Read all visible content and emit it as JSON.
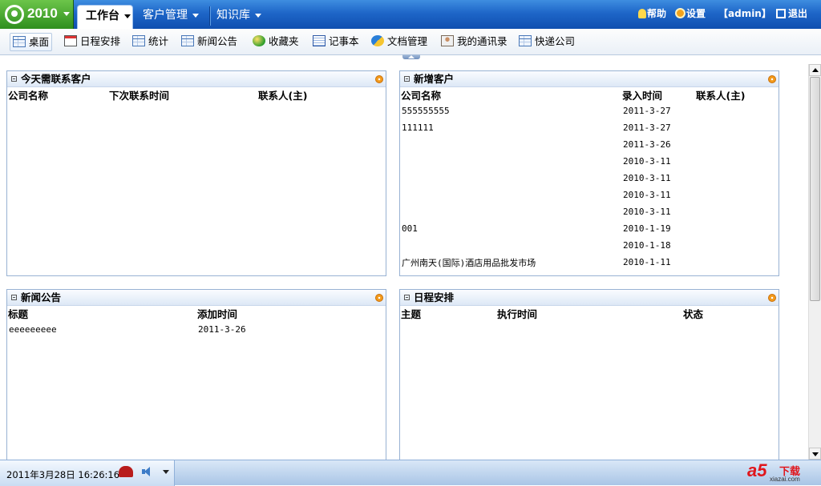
{
  "app": {
    "version": "2010"
  },
  "nav": {
    "tabs": [
      {
        "label": "工作台",
        "active": true
      },
      {
        "label": "客户管理",
        "active": false
      },
      {
        "label": "知识库",
        "active": false
      }
    ],
    "links": {
      "help": "帮助",
      "settings": "设置",
      "user": "【admin】",
      "logout": "退出"
    }
  },
  "toolbar": {
    "items": [
      {
        "label": "桌面",
        "icon": "table-icon",
        "active": true
      },
      {
        "label": "日程安排",
        "icon": "calendar-icon"
      },
      {
        "label": "统计",
        "icon": "table-icon"
      },
      {
        "label": "新闻公告",
        "icon": "table-icon"
      },
      {
        "label": "收藏夹",
        "icon": "favorites-icon"
      },
      {
        "label": "记事本",
        "icon": "notepad-icon"
      },
      {
        "label": "文档管理",
        "icon": "document-icon"
      },
      {
        "label": "我的通讯录",
        "icon": "contacts-icon"
      },
      {
        "label": "快递公司",
        "icon": "table-icon"
      }
    ]
  },
  "panels": {
    "today_contact": {
      "title": "今天需联系客户",
      "columns": [
        "公司名称",
        "下次联系时间",
        "联系人(主)"
      ],
      "rows": []
    },
    "new_customers": {
      "title": "新增客户",
      "columns": [
        "公司名称",
        "录入时间",
        "联系人(主)"
      ],
      "rows": [
        [
          "555555555",
          "2011-3-27",
          ""
        ],
        [
          "111111",
          "2011-3-27",
          ""
        ],
        [
          "",
          "2011-3-26",
          ""
        ],
        [
          "",
          "2010-3-11",
          ""
        ],
        [
          "",
          "2010-3-11",
          ""
        ],
        [
          "",
          "2010-3-11",
          ""
        ],
        [
          "",
          "2010-3-11",
          ""
        ],
        [
          "001",
          "2010-1-19",
          ""
        ],
        [
          "",
          "2010-1-18",
          ""
        ],
        [
          "广州南天(国际)酒店用品批发市场",
          "2010-1-11",
          ""
        ]
      ]
    },
    "news": {
      "title": "新闻公告",
      "columns": [
        "标题",
        "添加时间"
      ],
      "rows": [
        [
          "eeeeeeeee",
          "2011-3-26"
        ]
      ]
    },
    "schedule": {
      "title": "日程安排",
      "columns": [
        "主题",
        "执行时间",
        "状态"
      ],
      "rows": []
    }
  },
  "statusbar": {
    "datetime": "2011年3月28日 16:26:16"
  },
  "watermark": {
    "brand": "a5",
    "text": "下载",
    "url": "xiazai.com"
  },
  "colors": {
    "nav_blue": "#1e66c8",
    "logo_green": "#2f8f1e",
    "panel_border": "#98b2d3"
  }
}
